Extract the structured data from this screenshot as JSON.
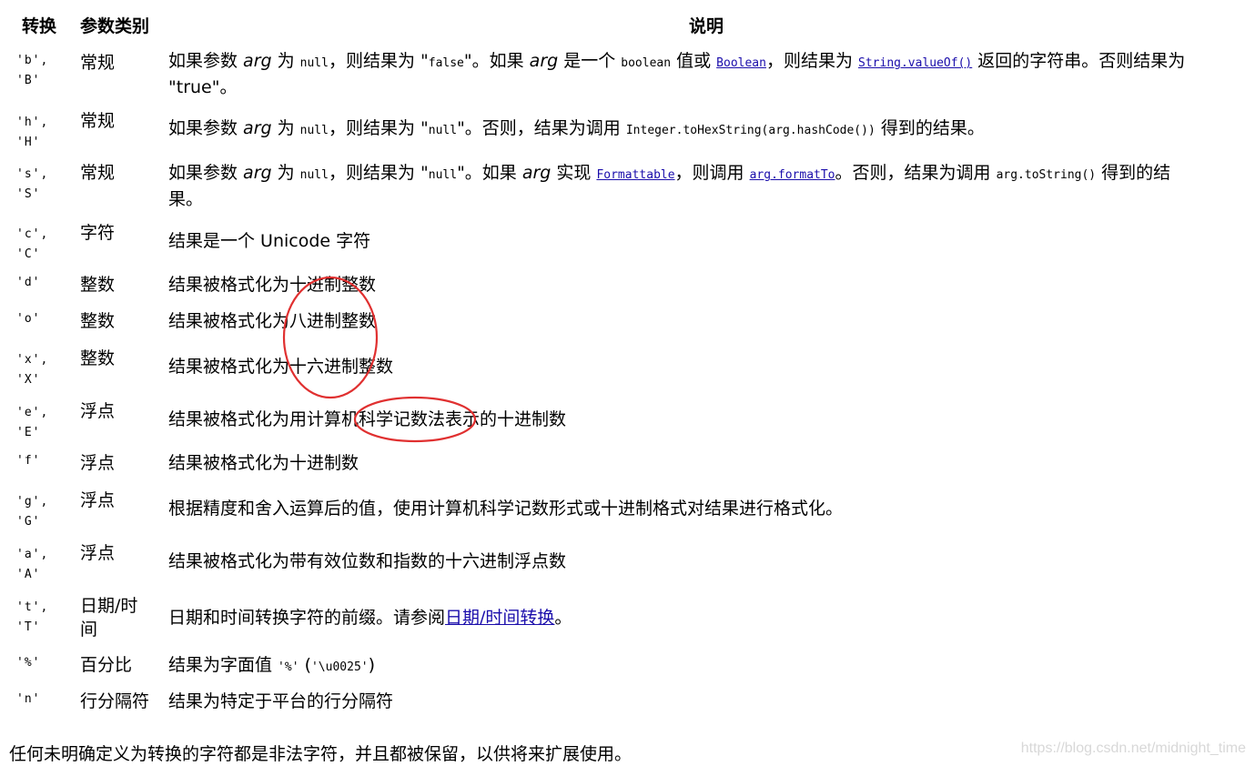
{
  "header": {
    "conversion": "转换",
    "category": "参数类别",
    "description": "说明"
  },
  "rows": [
    {
      "conv": "'b',\n'B'",
      "cat": "常规",
      "desc": {
        "p1": "如果参数 ",
        "i1": "arg",
        "p2": " 为 ",
        "m1": "null",
        "p3": "，则结果为 \"",
        "m2": "false",
        "p4": "\"。如果 ",
        "i2": "arg",
        "p5": " 是一个 ",
        "m3": "boolean",
        "p6": " 值或 ",
        "l1": "Boolean",
        "p7": "，则结果为 ",
        "l2": "String.valueOf()",
        "p8": " 返回的字符串。否则结果为\n\"true\"。"
      }
    },
    {
      "conv": "'h',\n'H'",
      "cat": "常规",
      "desc": {
        "p1": "如果参数 ",
        "i1": "arg",
        "p2": " 为 ",
        "m1": "null",
        "p3": "，则结果为 \"",
        "m2": "null",
        "p4": "\"。否则，结果为调用 ",
        "m3": "Integer.toHexString(arg.hashCode())",
        "p5": " 得到的结果。"
      }
    },
    {
      "conv": "'s',\n'S'",
      "cat": "常规",
      "desc": {
        "p1": "如果参数 ",
        "i1": "arg",
        "p2": " 为 ",
        "m1": "null",
        "p3": "，则结果为 \"",
        "m2": "null",
        "p4": "\"。如果 ",
        "i2": "arg",
        "p5": " 实现 ",
        "l1": "Formattable",
        "p6": "，则调用 ",
        "l2": "arg.formatTo",
        "p7": "。否则，结果为调用 ",
        "m3": "arg.toString()",
        "p8": " 得到的结\n果。"
      }
    },
    {
      "conv": "'c',\n'C'",
      "cat": "字符",
      "text": "结果是一个 Unicode 字符"
    },
    {
      "conv": "'d'",
      "cat": "整数",
      "text": "结果被格式化为十进制整数"
    },
    {
      "conv": "'o'",
      "cat": "整数",
      "text": "结果被格式化为八进制整数"
    },
    {
      "conv": "'x',\n'X'",
      "cat": "整数",
      "text": "结果被格式化为十六进制整数"
    },
    {
      "conv": "'e',\n'E'",
      "cat": "浮点",
      "text": "结果被格式化为用计算机科学记数法表示的十进制数"
    },
    {
      "conv": "'f'",
      "cat": "浮点",
      "text": "结果被格式化为十进制数"
    },
    {
      "conv": "'g',\n'G'",
      "cat": "浮点",
      "text": "根据精度和舍入运算后的值，使用计算机科学记数形式或十进制格式对结果进行格式化。"
    },
    {
      "conv": "'a',\n'A'",
      "cat": "浮点",
      "text": "结果被格式化为带有效位数和指数的十六进制浮点数"
    },
    {
      "conv": "'t',\n'T'",
      "cat": "日期/时\n间",
      "desc": {
        "p1": "日期和时间转换字符的前缀。请参阅",
        "l1": "日期/时间转换",
        "p2": "。"
      }
    },
    {
      "conv": "'%'",
      "cat": "百分比",
      "desc": {
        "p1": "结果为字面值 ",
        "m1": "'%'",
        "p2": " (",
        "m2": "'\\u0025'",
        "p3": ")"
      }
    },
    {
      "conv": "'n'",
      "cat": "行分隔符",
      "text": "结果为特定于平台的行分隔符"
    }
  ],
  "footer": "任何未明确定义为转换的字符都是非法字符，并且都被保留，以供将来扩展使用。",
  "watermark": "https://blog.csdn.net/midnight_time",
  "annotation_color": "#e03030"
}
